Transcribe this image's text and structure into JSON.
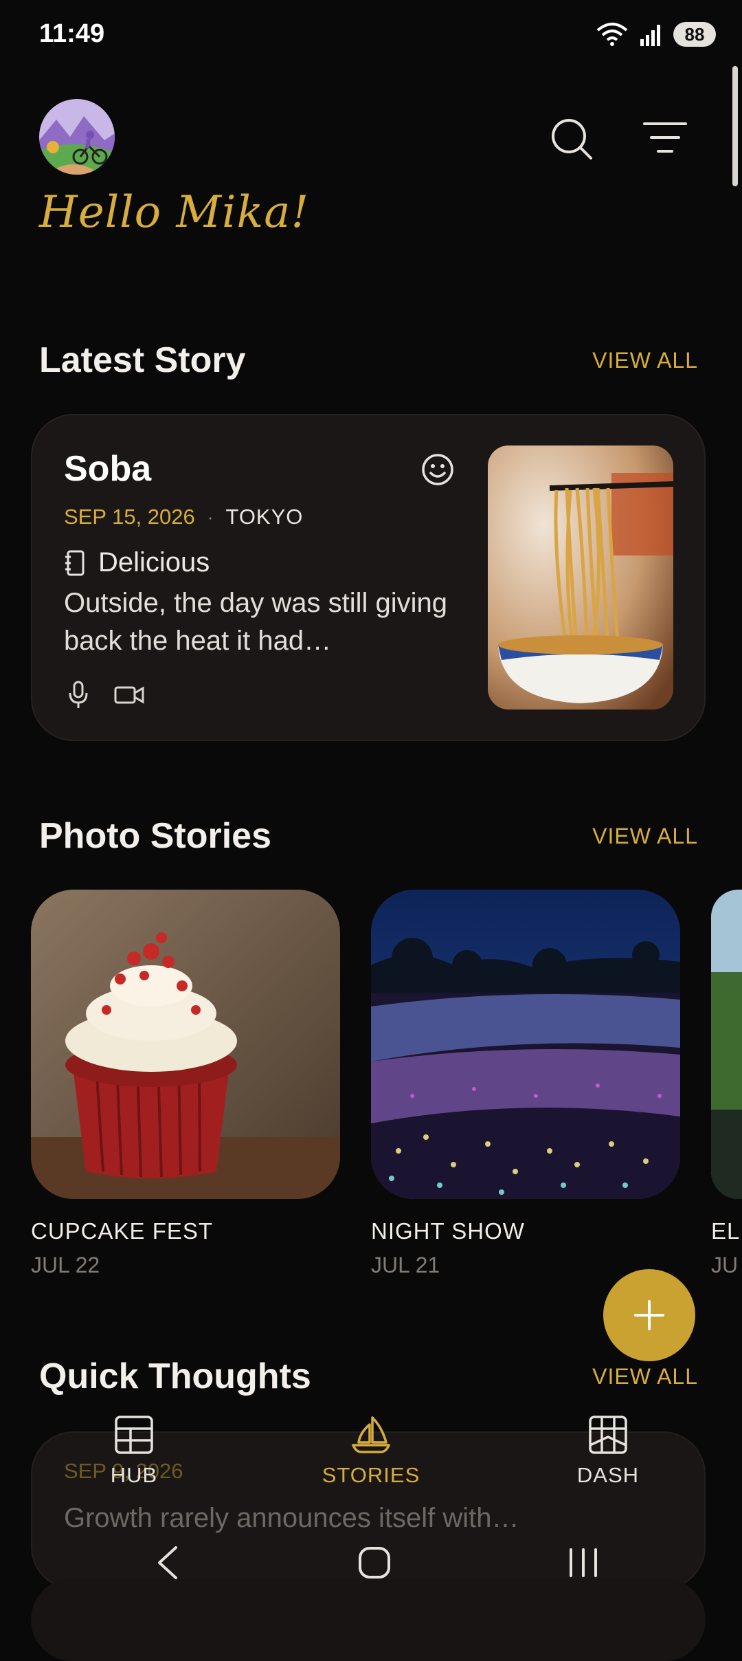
{
  "status_bar": {
    "time": "11:49",
    "battery": "88"
  },
  "header": {
    "greeting": "Hello Mika!"
  },
  "latest_story": {
    "section_title": "Latest Story",
    "view_all": "VIEW ALL",
    "title": "Soba",
    "date": "SEP 15, 2026",
    "separator": "·",
    "location": "TOKYO",
    "mood": "Delicious",
    "excerpt": "Outside, the day was still giving back the heat it had…"
  },
  "photo_stories": {
    "section_title": "Photo Stories",
    "view_all": "VIEW ALL",
    "items": [
      {
        "title": "CUPCAKE FEST",
        "date": "JUL 22"
      },
      {
        "title": "NIGHT SHOW",
        "date": "JUL 21"
      },
      {
        "title": "EL",
        "date": "JU"
      }
    ]
  },
  "quick_thoughts": {
    "section_title": "Quick Thoughts",
    "view_all": "VIEW ALL",
    "date": "SEP 9, 2026",
    "text": "Growth rarely announces itself with…"
  },
  "bottom_nav": {
    "items": [
      {
        "label": "HUB",
        "icon": "table-icon",
        "active": false
      },
      {
        "label": "STORIES",
        "icon": "sailboat-icon",
        "active": true
      },
      {
        "label": "DASH",
        "icon": "dashboard-icon",
        "active": false
      }
    ]
  },
  "colors": {
    "accent": "#d7ad3c",
    "background": "#0a0909",
    "card": "#1a1716",
    "fab": "#c9a232"
  }
}
